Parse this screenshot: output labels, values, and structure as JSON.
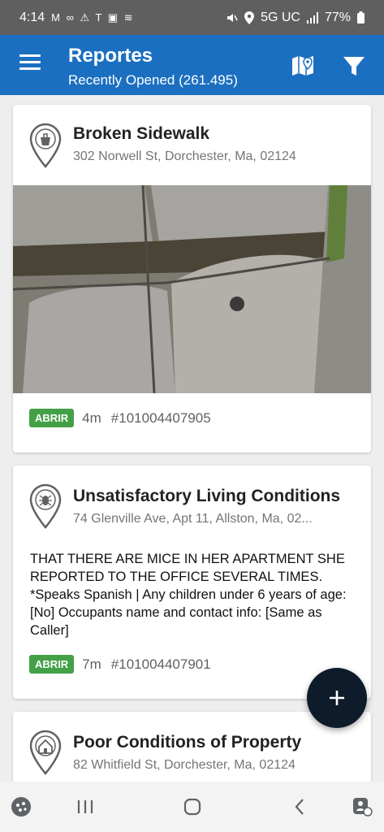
{
  "status_bar": {
    "time": "4:14",
    "left_icons": "M ∞ ⚠ T ▣ ≋",
    "network": "5G UC",
    "battery": "77%"
  },
  "header": {
    "title": "Reportes",
    "subtitle": "Recently Opened (261.495)"
  },
  "reports": [
    {
      "title": "Broken Sidewalk",
      "address": "302 Norwell St, Dorchester, Ma, 02124",
      "status": "ABRIR",
      "age": "4m",
      "id": "#101004407905",
      "icon": "trash-bin-pin-icon"
    },
    {
      "title": "Unsatisfactory Living Conditions",
      "address": "74 Glenville Ave, Apt 11, Allston, Ma, 02...",
      "description": "THAT THERE ARE MICE IN HER APARTMENT SHE REPORTED TO THE OFFICE SEVERAL TIMES. *Speaks Spanish | Any children under 6 years of age: [No]  Occupants name and contact info: [Same as Caller]",
      "status": "ABRIR",
      "age": "7m",
      "id": "#101004407901",
      "icon": "bug-pin-icon"
    },
    {
      "title": "Poor Conditions of Property",
      "address": "82 Whitfield St, Dorchester, Ma, 02124",
      "icon": "house-pin-icon"
    }
  ],
  "colors": {
    "app_bar": "#1b6fc1",
    "status_badge": "#43a047",
    "fab": "#0d1b2a"
  },
  "icons": {
    "menu": "menu-icon",
    "map": "map-pin-icon",
    "filter": "filter-icon",
    "fab": "plus-icon"
  }
}
